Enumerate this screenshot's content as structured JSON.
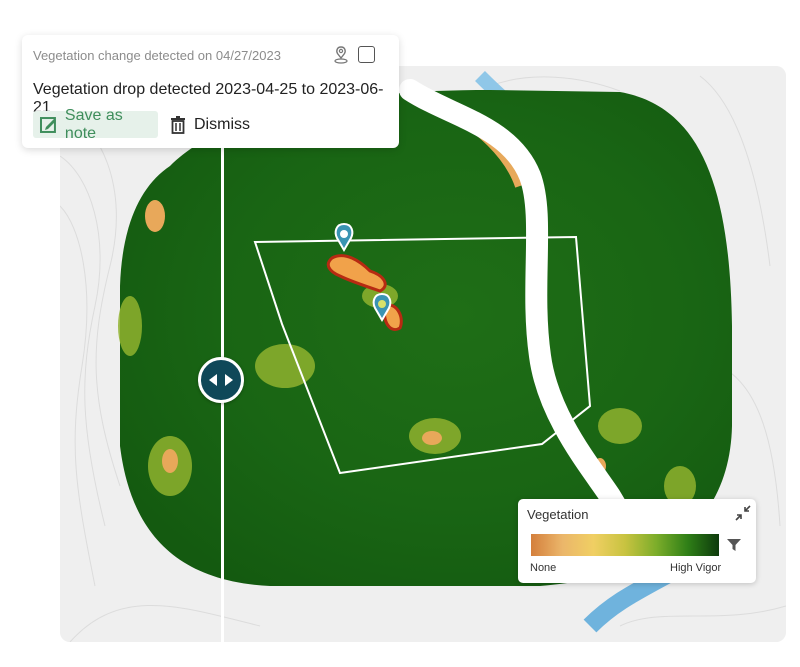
{
  "popup": {
    "header": "Vegetation change detected on 04/27/2023",
    "body": "Vegetation drop detected 2023-04-25 to 2023-06-21",
    "save_label": "Save as note",
    "dismiss_label": "Dismiss"
  },
  "legend": {
    "title": "Vegetation",
    "min_label": "None",
    "max_label": "High Vigor",
    "ramp_colors": [
      "#d47f3c",
      "#ebb66a",
      "#f0cf63",
      "#c8c340",
      "#7cad2a",
      "#2f7f17",
      "#0d3a0c"
    ]
  },
  "colors": {
    "accent": "#0f4859",
    "pin": "#3a94b3",
    "save_green": "#3f8e5c",
    "vegetation_dark": "#155e12",
    "river": "#ffffff",
    "change_red": "#b72a12"
  },
  "icons": {
    "pin": "location-pin-icon",
    "save": "edit-note-icon",
    "dismiss": "trash-icon",
    "swipe": "swipe-arrows-icon",
    "collapse": "collapse-icon",
    "filter": "filter-icon"
  }
}
